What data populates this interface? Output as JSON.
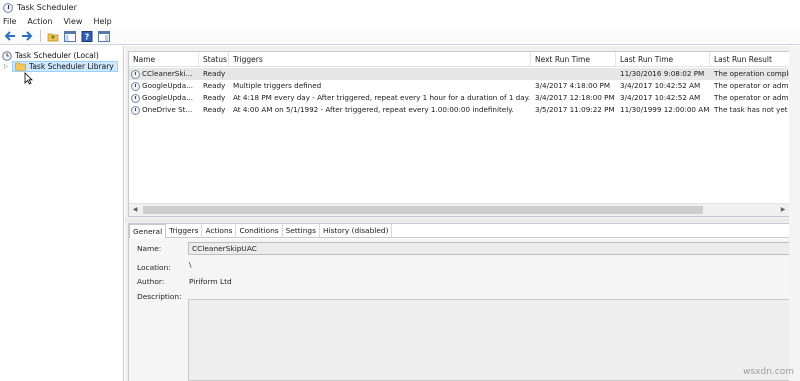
{
  "window": {
    "title": "Task Scheduler"
  },
  "menu": [
    "File",
    "Action",
    "View",
    "Help"
  ],
  "toolbar": {
    "buttons": [
      "back-arrow-icon",
      "forward-arrow-icon",
      "folder-up-icon",
      "console-tree-icon",
      "help-icon",
      "panel-icon"
    ]
  },
  "tree": {
    "root": "Task Scheduler (Local)",
    "library": "Task Scheduler Library"
  },
  "tasks": {
    "columns": [
      "Name",
      "Status",
      "Triggers",
      "Next Run Time",
      "Last Run Time",
      "Last Run Result"
    ],
    "rows": [
      {
        "name": "CCleanerSki...",
        "status": "Ready",
        "triggers": "",
        "next": "",
        "last": "11/30/2016 9:08:02 PM",
        "result": "The operation comple"
      },
      {
        "name": "GoogleUpda...",
        "status": "Ready",
        "triggers": "Multiple triggers defined",
        "next": "3/4/2017 4:18:00 PM",
        "last": "3/4/2017 10:42:52 AM",
        "result": "The operator or admin"
      },
      {
        "name": "GoogleUpda...",
        "status": "Ready",
        "triggers": "At 4:18 PM every day - After triggered, repeat every 1 hour for a duration of 1 day.",
        "next": "3/4/2017 12:18:00 PM",
        "last": "3/4/2017 10:42:52 AM",
        "result": "The operator or admir"
      },
      {
        "name": "OneDrive St...",
        "status": "Ready",
        "triggers": "At 4:00 AM on 5/1/1992 - After triggered, repeat every 1.00:00:00 indefinitely.",
        "next": "3/5/2017 11:09:22 PM",
        "last": "11/30/1999 12:00:00 AM",
        "result": "The task has not yet ru"
      }
    ]
  },
  "details": {
    "tabs": [
      "General",
      "Triggers",
      "Actions",
      "Conditions",
      "Settings",
      "History (disabled)"
    ],
    "name_label": "Name:",
    "name_value": "CCleanerSkipUAC",
    "location_label": "Location:",
    "location_value": "\\",
    "author_label": "Author:",
    "author_value": "Piriform Ltd",
    "description_label": "Description:"
  },
  "watermark": "wsxdn.com"
}
